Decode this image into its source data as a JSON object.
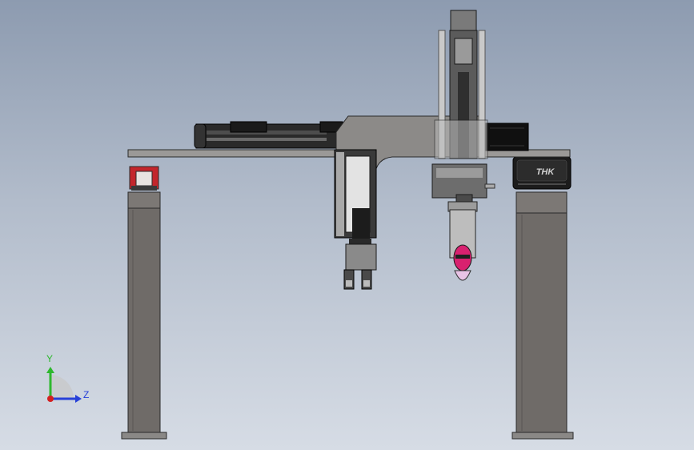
{
  "viewport": {
    "name": "cad-3d-viewport",
    "background_top": "#8d9bb0",
    "background_bottom": "#d6dce5"
  },
  "model": {
    "name": "gantry-robot-assembly",
    "column_color": "#6f6b68",
    "beam_color": "#8c8a88",
    "accent_red": "#c3262c",
    "tool_magenta": "#d8216f",
    "dark_part": "#1c1c1c"
  },
  "carriage_label": "THK",
  "triad": {
    "y_label": "Y",
    "z_label": "Z",
    "y_color": "#2eb82e",
    "z_color": "#2740d8",
    "x_color": "#d42020"
  }
}
